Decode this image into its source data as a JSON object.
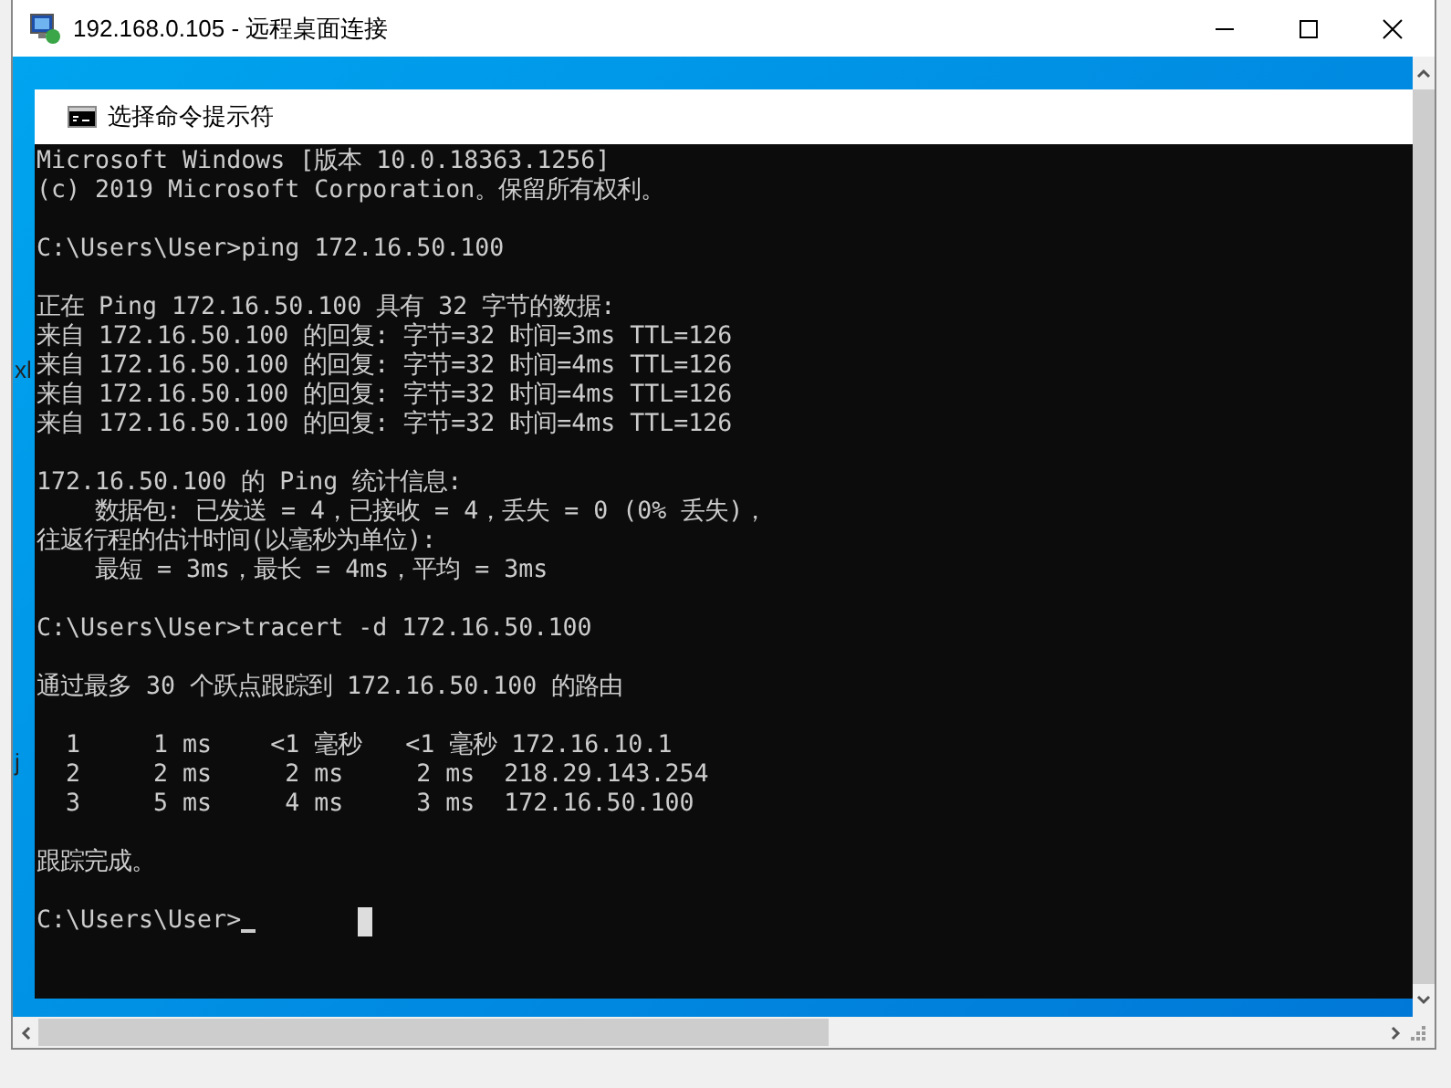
{
  "window": {
    "title": "192.168.0.105 - 远程桌面连接"
  },
  "desktop_fragments": [
    "xl",
    "j"
  ],
  "console_window": {
    "title": "选择命令提示符",
    "blocks": [
      [
        "Microsoft Windows [版本 10.0.18363.1256]",
        "(c) 2019 Microsoft Corporation。保留所有权利。"
      ],
      [
        "C:\\Users\\User>ping 172.16.50.100"
      ],
      [
        "正在 Ping 172.16.50.100 具有 32 字节的数据:",
        "来自 172.16.50.100 的回复: 字节=32 时间=3ms TTL=126",
        "来自 172.16.50.100 的回复: 字节=32 时间=4ms TTL=126",
        "来自 172.16.50.100 的回复: 字节=32 时间=4ms TTL=126",
        "来自 172.16.50.100 的回复: 字节=32 时间=4ms TTL=126"
      ],
      [
        "172.16.50.100 的 Ping 统计信息:",
        "    数据包: 已发送 = 4，已接收 = 4，丢失 = 0 (0% 丢失)，",
        "往返行程的估计时间(以毫秒为单位):",
        "    最短 = 3ms，最长 = 4ms，平均 = 3ms"
      ],
      [
        "C:\\Users\\User>tracert -d 172.16.50.100"
      ],
      [
        "通过最多 30 个跃点跟踪到 172.16.50.100 的路由"
      ],
      [
        "  1     1 ms    <1 毫秒   <1 毫秒 172.16.10.1",
        "  2     2 ms     2 ms     2 ms  218.29.143.254",
        "  3     5 ms     4 ms     3 ms  172.16.50.100"
      ],
      [
        "跟踪完成。"
      ]
    ],
    "prompt": "C:\\Users\\User>"
  }
}
